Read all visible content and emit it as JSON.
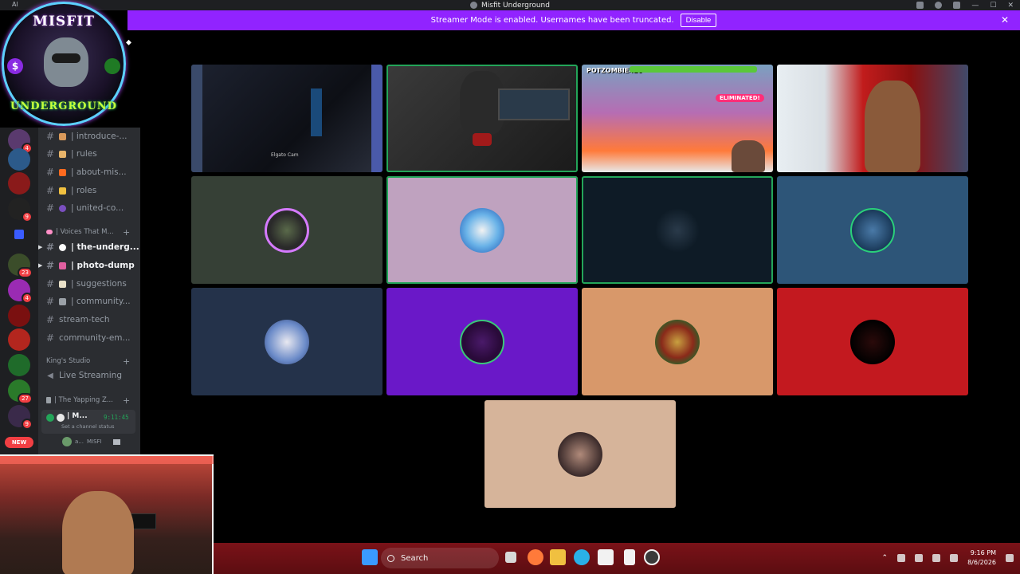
{
  "window": {
    "title": "Misfit Underground",
    "corner_label": "Al"
  },
  "banner": {
    "text": "Streamer Mode is enabled. Usernames have been truncated.",
    "disable_label": "Disable",
    "close_glyph": "✕"
  },
  "logo": {
    "top_text": "MISFIT",
    "bottom_text": "UNDERGROUND",
    "dollar_glyph": "$"
  },
  "rail": {
    "badges": [
      "4",
      "9",
      "23",
      "4",
      "27",
      "9"
    ],
    "new_label": "NEW"
  },
  "channels": {
    "top_items": [
      {
        "label": "| introduce-...",
        "icon": "hand-icon"
      },
      {
        "label": "| rules",
        "icon": "scroll-icon"
      },
      {
        "label": "| about-mis...",
        "icon": "lightning-icon"
      },
      {
        "label": "| roles",
        "icon": "tag-icon"
      },
      {
        "label": "| united-co...",
        "icon": "globe-icon"
      }
    ],
    "category_voices": "| Voices That M...",
    "voices_items": [
      {
        "label": "| the-underg...",
        "active": true
      },
      {
        "label": "| photo-dump",
        "active": true
      },
      {
        "label": "| suggestions",
        "active": false
      },
      {
        "label": "| community...",
        "active": false
      },
      {
        "label": "stream-tech",
        "active": false
      },
      {
        "label": "community-em...",
        "active": false
      }
    ],
    "category_kings": "King's Studio",
    "live_streaming": "Live Streaming",
    "category_yapping": "| The Yapping Z...",
    "voice_user": {
      "name": "| M...",
      "time": "9:11:45",
      "status": "Set a channel status"
    },
    "sub_user": {
      "name": "a...",
      "tag": "MISFI"
    }
  },
  "tiles": {
    "cam_label": "Elgato Cam",
    "game_tag": "POTZOMBIE420",
    "eliminated": "ELIMINATED!"
  },
  "taskbar": {
    "search_label": "Search",
    "time": "9:16 PM",
    "date": "8/6/2026"
  },
  "colors": {
    "banner": "#9123ff",
    "speaking_ring": "#23a559",
    "taskbar": "#6e1014"
  }
}
